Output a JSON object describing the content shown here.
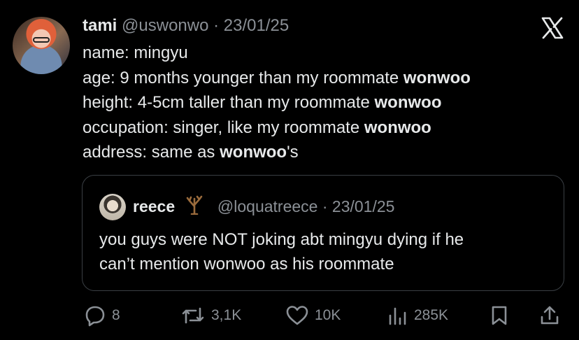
{
  "tweet": {
    "display_name": "tami",
    "handle": "@uswonwo",
    "separator": "·",
    "date": "23/01/25",
    "lines": [
      {
        "label": "name:",
        "text": " mingyu",
        "bold": "",
        "suffix": ""
      },
      {
        "label": "age:",
        "text": " 9 months younger than my roommate ",
        "bold": "wonwoo",
        "suffix": ""
      },
      {
        "label": "height:",
        "text": " 4-5cm taller than my roommate ",
        "bold": "wonwoo",
        "suffix": ""
      },
      {
        "label": "occupation:",
        "text": " singer, like my roommate ",
        "bold": "wonwoo",
        "suffix": ""
      },
      {
        "label": "address:",
        "text": " same as ",
        "bold": "wonwoo",
        "suffix": "'s"
      }
    ]
  },
  "quote": {
    "display_name": "reece",
    "emoji_icon": "bare-tree-icon",
    "handle": "@loquatreece",
    "separator": "·",
    "date": "23/01/25",
    "line1": "you guys were NOT joking abt mingyu dying if he",
    "line2": "can’t mention wonwoo as his roommate"
  },
  "actions": {
    "replies": "8",
    "reposts": "3,1K",
    "likes": "10K",
    "views": "285K"
  },
  "icons": {
    "x_logo": "x-logo-icon",
    "reply": "reply-icon",
    "repost": "repost-icon",
    "like": "heart-icon",
    "views": "views-icon",
    "bookmark": "bookmark-icon",
    "share": "share-icon"
  },
  "colors": {
    "background": "#000000",
    "text": "#e7e9ea",
    "muted": "#8b9096",
    "border": "#3a3f44"
  }
}
